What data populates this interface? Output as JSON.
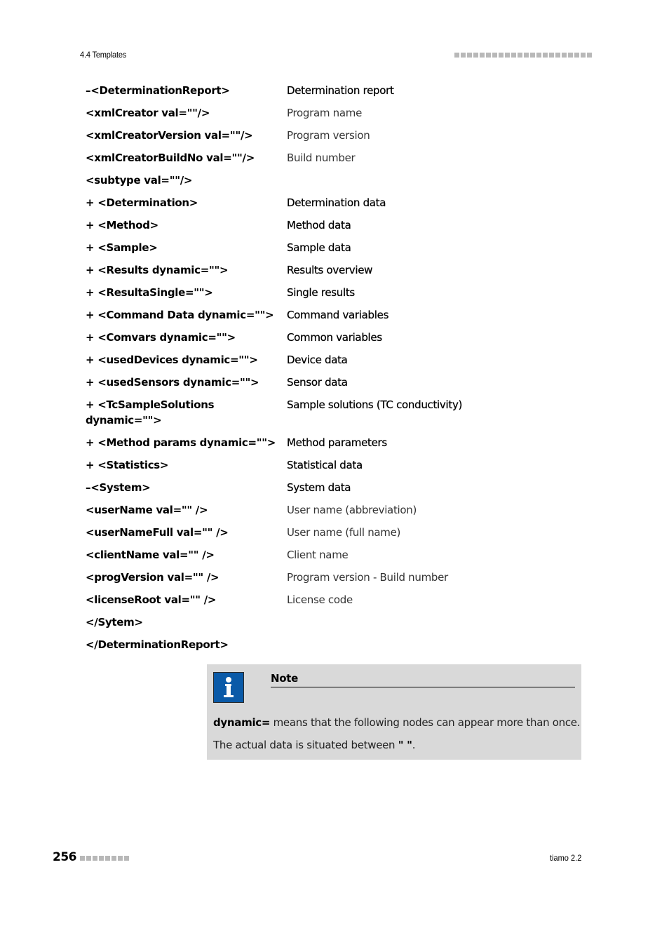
{
  "header": {
    "section": "4.4 Templates",
    "decoration_square_count": 22
  },
  "rows": [
    {
      "tag": "–<DeterminationReport>",
      "desc": "Determination report",
      "desc_style": "strong"
    },
    {
      "tag": "<xmlCreator val=\"\"/>",
      "desc": "Program name",
      "desc_style": "light"
    },
    {
      "tag": "<xmlCreatorVersion val=\"\"/>",
      "desc": "Program version",
      "desc_style": "light"
    },
    {
      "tag": "<xmlCreatorBuildNo val=\"\"/>",
      "desc": "Build number",
      "desc_style": "light"
    },
    {
      "tag": "<subtype val=\"\"/>",
      "desc": "",
      "desc_style": "light"
    },
    {
      "tag": "+ <Determination>",
      "desc": "Determination data",
      "desc_style": "strong"
    },
    {
      "tag": "+ <Method>",
      "desc": "Method data",
      "desc_style": "strong"
    },
    {
      "tag": "+ <Sample>",
      "desc": "Sample data",
      "desc_style": "strong"
    },
    {
      "tag": "+ <Results dynamic=\"\">",
      "desc": "Results overview",
      "desc_style": "strong"
    },
    {
      "tag": "+ <ResultaSingle=\"\">",
      "desc": "Single results",
      "desc_style": "strong"
    },
    {
      "tag": "+ <Command Data dynamic=\"\">",
      "desc": "Command variables",
      "desc_style": "strong"
    },
    {
      "tag": "+ <Comvars dynamic=\"\">",
      "desc": "Common variables",
      "desc_style": "strong"
    },
    {
      "tag": "+ <usedDevices dynamic=\"\">",
      "desc": "Device data",
      "desc_style": "strong"
    },
    {
      "tag": "+ <usedSensors dynamic=\"\">",
      "desc": "Sensor data",
      "desc_style": "strong"
    },
    {
      "tag": "+ <TcSampleSolutions dynamic=\"\">",
      "desc": "Sample solutions (TC conductivity)",
      "desc_style": "strong"
    },
    {
      "tag": "+ <Method params dynamic=\"\">",
      "desc": "Method parameters",
      "desc_style": "strong"
    },
    {
      "tag": "+ <Statistics>",
      "desc": "Statistical data",
      "desc_style": "strong"
    },
    {
      "tag": "–<System>",
      "desc": "System data",
      "desc_style": "strong"
    },
    {
      "tag": "<userName val=\"\" />",
      "desc": "User name (abbreviation)",
      "desc_style": "light"
    },
    {
      "tag": "<userNameFull val=\"\" />",
      "desc": "User name (full name)",
      "desc_style": "light"
    },
    {
      "tag": "<clientName val=\"\" />",
      "desc": "Client name",
      "desc_style": "light"
    },
    {
      "tag": "<progVersion val=\"\" />",
      "desc": "Program version - Build number",
      "desc_style": "light"
    },
    {
      "tag": "<licenseRoot val=\"\" />",
      "desc": "License code",
      "desc_style": "light"
    },
    {
      "tag": "</Sytem>",
      "desc": "",
      "desc_style": "light"
    },
    {
      "tag": "</DeterminationReport>",
      "desc": "",
      "desc_style": "light"
    }
  ],
  "note": {
    "icon": "info-icon",
    "title": "Note",
    "line1_bold": "dynamic=",
    "line1_rest": " means that the following nodes can appear more than once.",
    "line2_prefix": "The actual data is situated between ",
    "line2_bold": "\" \"",
    "line2_suffix": "."
  },
  "footer": {
    "page_number": "256",
    "decoration_square_count": 8,
    "product": "tiamo 2.2"
  }
}
